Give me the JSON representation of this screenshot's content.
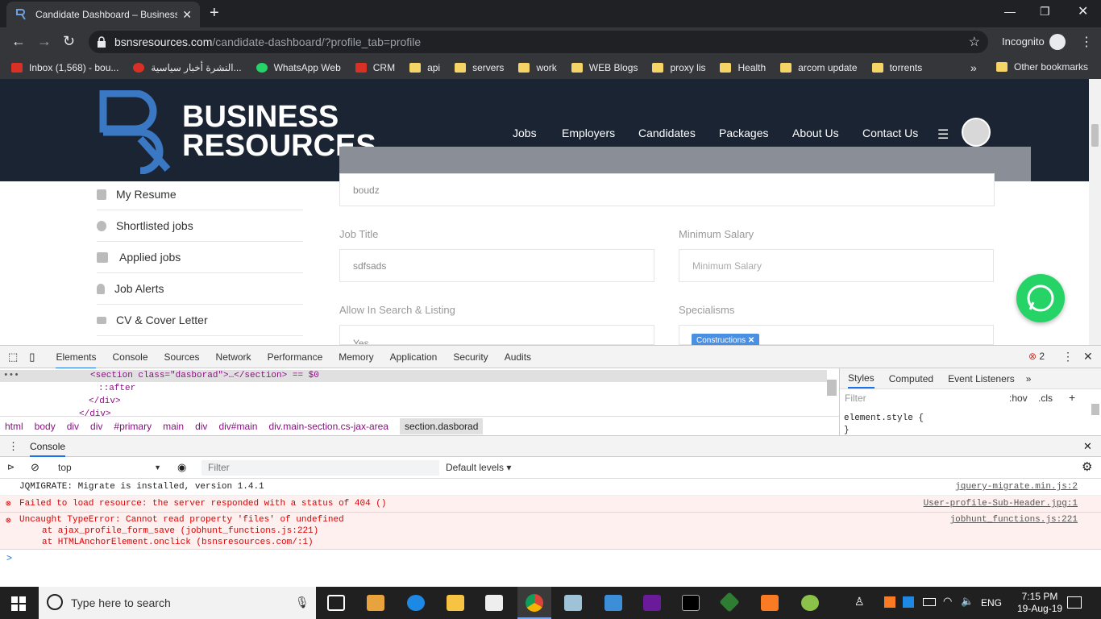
{
  "browser": {
    "tab_title": "Candidate Dashboard – Business Resources",
    "new_tab_label": "+",
    "url_host": "bsnsresources.com",
    "url_path": "/candidate-dashboard/?profile_tab=profile",
    "incognito_label": "Incognito",
    "bookmarks": [
      {
        "label": "Inbox (1,568) - bou...",
        "icon": "gmail-icon",
        "color": "#d93025"
      },
      {
        "label": "النشرة أخبار سياسية...",
        "icon": "e-icon",
        "color": "#d93025"
      },
      {
        "label": "WhatsApp Web",
        "icon": "whatsapp-icon",
        "color": "#25d366"
      },
      {
        "label": "CRM",
        "icon": "v-icon",
        "color": "#d93025"
      },
      {
        "label": "api",
        "icon": "folder-icon",
        "color": "#f6d365"
      },
      {
        "label": "servers",
        "icon": "folder-icon",
        "color": "#f6d365"
      },
      {
        "label": "work",
        "icon": "folder-icon",
        "color": "#f6d365"
      },
      {
        "label": "WEB Blogs",
        "icon": "folder-icon",
        "color": "#f6d365"
      },
      {
        "label": "proxy lis",
        "icon": "folder-icon",
        "color": "#f6d365"
      },
      {
        "label": "Health",
        "icon": "folder-icon",
        "color": "#f6d365"
      },
      {
        "label": "arcom update",
        "icon": "folder-icon",
        "color": "#f6d365"
      },
      {
        "label": "torrents",
        "icon": "folder-icon",
        "color": "#f6d365"
      }
    ],
    "bookmarks_more": "»",
    "other_bookmarks": "Other bookmarks"
  },
  "site": {
    "logo_line1": "BUSINESS",
    "logo_line2": "RESOURCES",
    "nav": [
      "Jobs",
      "Employers",
      "Candidates",
      "Packages",
      "About Us",
      "Contact Us"
    ],
    "sidebar": [
      "My Resume",
      "Shortlisted jobs",
      "Applied jobs",
      "Job Alerts",
      "CV & Cover Letter"
    ],
    "form": {
      "name_value": "boudz",
      "job_title_label": "Job Title",
      "job_title_value": "sdfsads",
      "min_salary_label": "Minimum Salary",
      "min_salary_placeholder": "Minimum Salary",
      "allow_label": "Allow In Search & Listing",
      "allow_value": "Yes",
      "specialisms_label": "Specialisms",
      "specialism_tag": "Constructions"
    }
  },
  "devtools": {
    "tabs": [
      "Elements",
      "Console",
      "Sources",
      "Network",
      "Performance",
      "Memory",
      "Application",
      "Security",
      "Audits"
    ],
    "error_count": "2",
    "dom_lines": [
      "<section class=\"dasborad\">…</section> == $0",
      "::after",
      "</div>",
      "</div>"
    ],
    "breadcrumbs": [
      "html",
      "body",
      "div",
      "div",
      "#primary",
      "main",
      "div",
      "div#main",
      "div.main-section.cs-jax-area",
      "section.dasborad"
    ],
    "styles_tabs": [
      "Styles",
      "Computed",
      "Event Listeners",
      "»"
    ],
    "styles_filter_placeholder": "Filter",
    "hov": ":hov",
    "cls": ".cls",
    "element_style": "element.style {",
    "element_style_close": "}",
    "drawer_title": "Console",
    "context": "top",
    "console_filter_placeholder": "Filter",
    "levels": "Default levels ▾",
    "messages": [
      {
        "type": "info",
        "text": "JQMIGRATE: Migrate is installed, version 1.4.1",
        "source": "jquery-migrate.min.js:2"
      },
      {
        "type": "error",
        "text": "Failed to load resource: the server responded with a status of 404 ()",
        "source": "User-profile-Sub-Header.jpg:1"
      },
      {
        "type": "error",
        "text": "Uncaught TypeError: Cannot read property 'files' of undefined",
        "line2": "at ajax_profile_form_save (jobhunt_functions.js:221)",
        "line3": "at HTMLAnchorElement.onclick (bsnsresources.com/:1)",
        "source": "jobhunt_functions.js:221"
      }
    ],
    "prompt": ">"
  },
  "taskbar": {
    "search_placeholder": "Type here to search",
    "lang": "ENG",
    "time": "7:15 PM",
    "date": "19-Aug-19"
  }
}
